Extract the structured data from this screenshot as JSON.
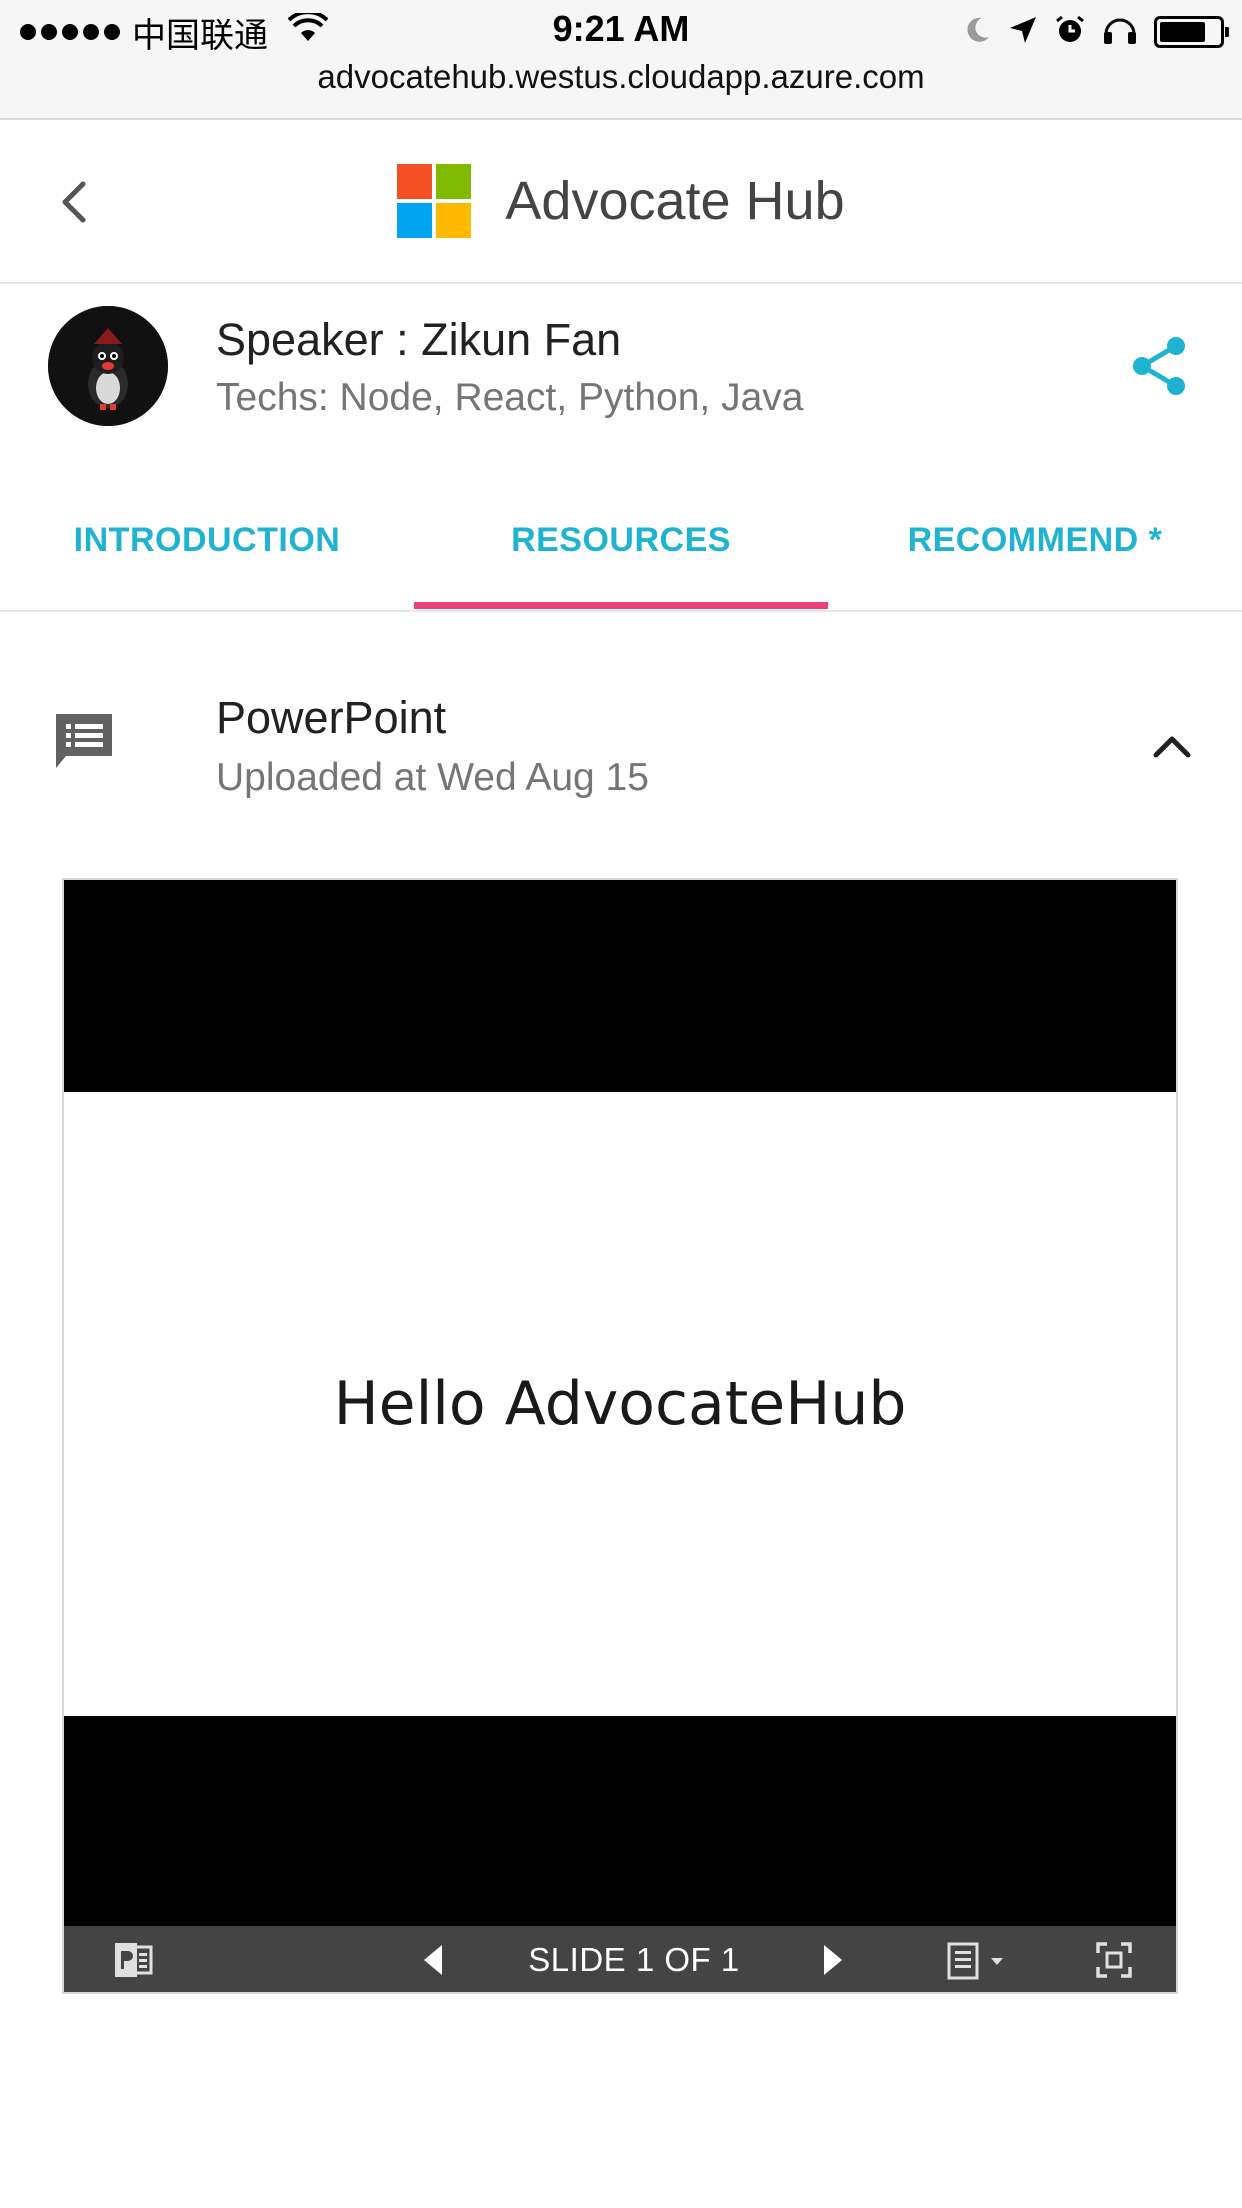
{
  "status_bar": {
    "carrier": "中国联通",
    "time": "9:21 AM"
  },
  "browser": {
    "url": "advocatehub.westus.cloudapp.azure.com"
  },
  "header": {
    "title": "Advocate Hub",
    "logo_colors": [
      "#f25022",
      "#7fba00",
      "#00a4ef",
      "#ffb900"
    ]
  },
  "speaker": {
    "name": "Speaker : Zikun Fan",
    "techs": "Techs: Node, React, Python, Java"
  },
  "tabs": [
    {
      "label": "INTRODUCTION",
      "active": false
    },
    {
      "label": "RESOURCES",
      "active": true
    },
    {
      "label": "RECOMMEND *",
      "active": false
    }
  ],
  "resource": {
    "title": "PowerPoint",
    "subtitle": "Uploaded at Wed Aug 15"
  },
  "viewer": {
    "slide_text": "Hello AdvocateHub",
    "slide_counter": "SLIDE 1 OF 1"
  },
  "colors": {
    "accent": "#1fb3d1",
    "tab_indicator": "#ec407a",
    "toolbar": "#444444"
  }
}
